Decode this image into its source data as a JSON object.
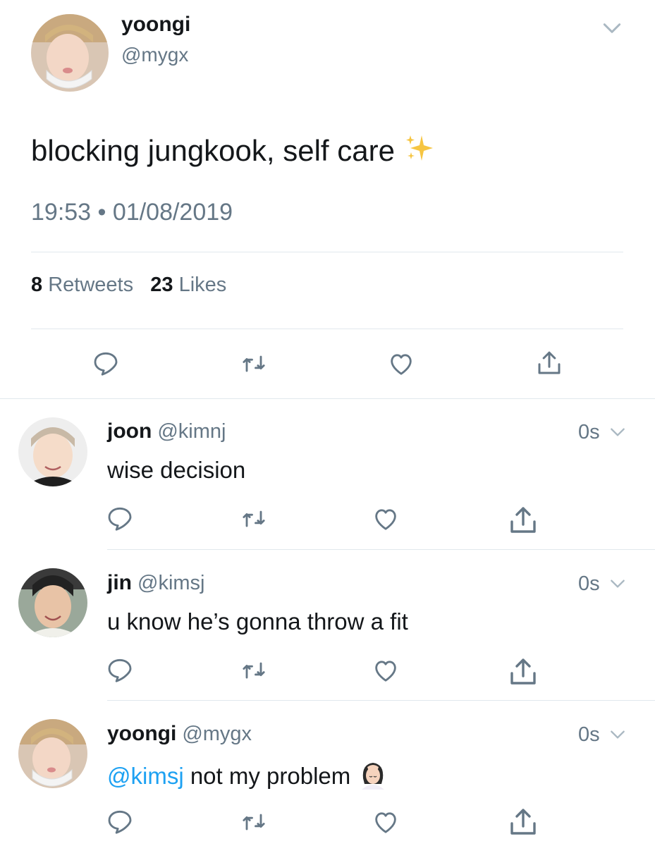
{
  "main_tweet": {
    "name": "yoongi",
    "handle": "@mygx",
    "text": "blocking jungkook, self care",
    "time": "19:53",
    "date": "01/08/2019",
    "separator": "•",
    "retweet_count": "8",
    "retweet_label": "Retweets",
    "like_count": "23",
    "like_label": "Likes"
  },
  "replies": [
    {
      "name": "joon",
      "handle": "@kimnj",
      "time": "0s",
      "text": "wise decision"
    },
    {
      "name": "jin",
      "handle": "@kimsj",
      "time": "0s",
      "text": "u know he’s gonna throw a fit"
    },
    {
      "name": "yoongi",
      "handle": "@mygx",
      "time": "0s",
      "mention": "@kimsj",
      "text": "not my problem"
    }
  ],
  "icons": [
    "reply-icon",
    "retweet-icon",
    "like-icon",
    "share-icon",
    "chevron-down-icon",
    "sparkles-emoji",
    "facepalm-emoji"
  ],
  "colors": {
    "accent": "#1da1f2",
    "text": "#14171a",
    "muted": "#657786",
    "divider": "#e1e8ed",
    "icon": "#657786"
  }
}
